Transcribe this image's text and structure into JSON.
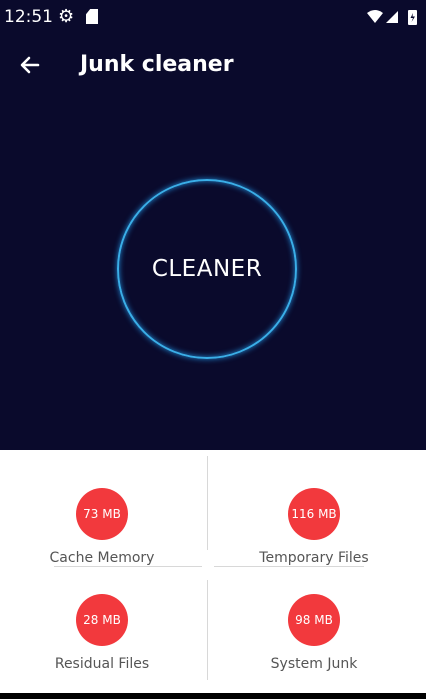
{
  "status_bar": {
    "time": "12:51"
  },
  "app_bar": {
    "title": "Junk cleaner"
  },
  "cleaner": {
    "label": "CLEANER"
  },
  "stats": [
    {
      "value": "73 MB",
      "label": "Cache Memory"
    },
    {
      "value": "116 MB",
      "label": "Temporary Files"
    },
    {
      "value": "28 MB",
      "label": "Residual Files"
    },
    {
      "value": "98 MB",
      "label": "System Junk"
    }
  ],
  "colors": {
    "header_bg": "#0a0a2c",
    "ring": "#3aaee8",
    "badge": "#f2393d"
  },
  "icons": [
    "settings-icon",
    "sd-card-icon",
    "wifi-icon",
    "signal-icon",
    "battery-icon",
    "back-arrow-icon"
  ]
}
